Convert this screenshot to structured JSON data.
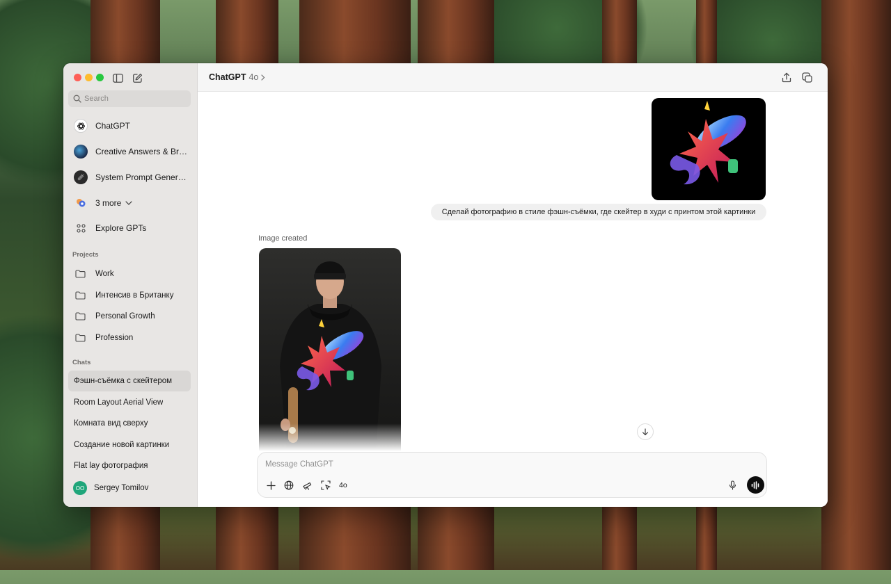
{
  "sidebar": {
    "search_placeholder": "Search",
    "gpts": [
      {
        "label": "ChatGPT",
        "icon": "chatgpt-logo-icon"
      },
      {
        "label": "Creative Answers & Brai...",
        "icon": "creative-answers-avatar"
      },
      {
        "label": "System Prompt Generator",
        "icon": "system-prompt-avatar"
      },
      {
        "label": "3 more",
        "icon": "more-gpts-icon"
      },
      {
        "label": "Explore GPTs",
        "icon": "grid-icon"
      }
    ],
    "projects_label": "Projects",
    "projects": [
      {
        "label": "Work"
      },
      {
        "label": "Интенсив в Британку"
      },
      {
        "label": "Personal Growth"
      },
      {
        "label": "Profession"
      }
    ],
    "chats_label": "Chats",
    "chats": [
      {
        "label": "Фэшн-съёмка с скейтером",
        "active": true
      },
      {
        "label": "Room Layout Aerial View"
      },
      {
        "label": "Комната вид сверху"
      },
      {
        "label": "Создание новой картинки"
      },
      {
        "label": "Flat lay фотография"
      }
    ],
    "user": {
      "initials": "OO",
      "name": "Sergey Tomilov"
    }
  },
  "header": {
    "title": "ChatGPT",
    "model": "4o"
  },
  "conversation": {
    "user_message": "Сделай фотографию в стиле фэшн-съёмки, где скейтер в худи с принтом этой картинки",
    "assistant_caption": "Image created"
  },
  "composer": {
    "placeholder": "Message ChatGPT",
    "model_label": "4o"
  },
  "colors": {
    "accent": "#0d0d0d",
    "sidebar_bg": "#e8e6e4",
    "avatar": "#1fa67a"
  }
}
